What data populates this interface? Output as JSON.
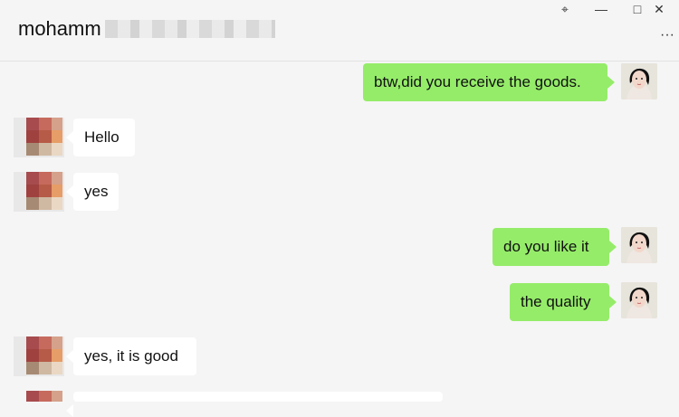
{
  "window": {
    "title": "mohamm",
    "controls": {
      "pin_glyph": "⌖",
      "minimize_glyph": "—",
      "maximize_glyph": "□",
      "close_glyph": "✕",
      "more_glyph": "···"
    }
  },
  "messages": [
    {
      "id": "m1",
      "sender": "self",
      "text": "btw,did you receive the goods."
    },
    {
      "id": "m2",
      "sender": "peer",
      "text": "Hello"
    },
    {
      "id": "m3",
      "sender": "peer",
      "text": "yes"
    },
    {
      "id": "m4",
      "sender": "self",
      "text": "do you like it"
    },
    {
      "id": "m5",
      "sender": "self",
      "text": "the quality"
    },
    {
      "id": "m6",
      "sender": "peer",
      "text": "yes, it is good"
    }
  ],
  "colors": {
    "outgoing_bubble": "#95ec69",
    "incoming_bubble": "#ffffff",
    "background": "#f5f5f5"
  }
}
